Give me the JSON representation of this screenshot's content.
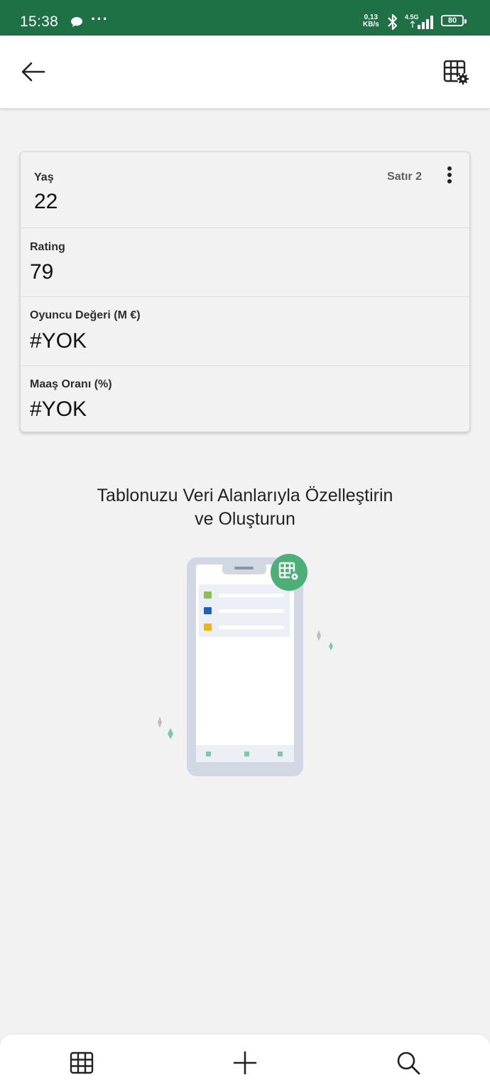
{
  "status_bar": {
    "time": "15:38",
    "more": "···",
    "speed_value": "0,13",
    "speed_unit": "KB/s",
    "network": "4.5G",
    "battery": "80",
    "chat_icon": "chat-bubble-icon",
    "bluetooth_icon": "bluetooth-icon",
    "signal_icon": "signal-bars-icon"
  },
  "app_bar": {
    "back_icon": "arrow-left-icon",
    "settings_icon": "table-settings-icon"
  },
  "record": {
    "row_label": "Satır 2",
    "fields": [
      {
        "label": "Yaş",
        "value": "22"
      },
      {
        "label": "Rating",
        "value": "79"
      },
      {
        "label": "Oyuncu Değeri (M €)",
        "value": "#YOK"
      },
      {
        "label": "Maaş Oranı (%)",
        "value": "#YOK"
      }
    ]
  },
  "promo": {
    "line1": "Tablonuzu Veri Alanlarıyla Özelleştirin",
    "line2": "ve Oluşturun"
  },
  "bottom_nav": {
    "items": [
      "grid-icon",
      "plus-icon",
      "search-icon"
    ]
  },
  "colors": {
    "status_bar": "#1e7145",
    "accent_green": "#4caf78",
    "background": "#f2f2f2",
    "list_green": "#8bc34a",
    "list_blue": "#1565c0",
    "list_orange": "#f5b400"
  }
}
